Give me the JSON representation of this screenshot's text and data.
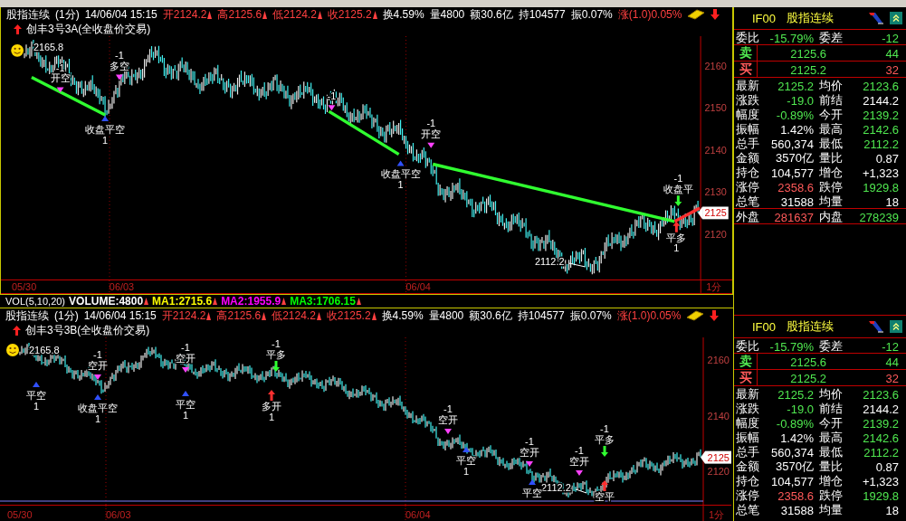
{
  "panes": [
    {
      "header": {
        "items": [
          {
            "kind": "title",
            "text": "股指连续"
          },
          {
            "kind": "stat",
            "text": "(1分)"
          },
          {
            "kind": "stat",
            "text": "14/06/04 15:15"
          },
          {
            "kind": "price",
            "text": "开2124.2"
          },
          {
            "kind": "price",
            "text": "高2125.6"
          },
          {
            "kind": "price",
            "text": "低2124.2"
          },
          {
            "kind": "price",
            "text": "收2125.2"
          },
          {
            "kind": "stat",
            "text": "换4.59%"
          },
          {
            "kind": "stat",
            "text": "量4800"
          },
          {
            "kind": "stat",
            "text": "额30.6亿"
          },
          {
            "kind": "stat",
            "text": "持104577"
          },
          {
            "kind": "stat",
            "text": "振0.07%"
          },
          {
            "kind": "change",
            "text": "涨(1.0)0.05%"
          }
        ]
      },
      "strategy": "创丰3号3A(全收盘价交易)",
      "high_label": "2165.8",
      "low_label": "2112.2",
      "price_tag": "2125",
      "y_ticks": [
        "2160",
        "2150",
        "2140",
        "2130",
        "2120"
      ],
      "dates": [
        "05/30",
        "06/03",
        "06/04"
      ],
      "period_label": "1分",
      "signals": [
        {
          "kind": "sell",
          "lines": [
            "-1",
            "开空"
          ]
        },
        {
          "kind": "sell",
          "lines": [
            "-1",
            "多空"
          ]
        },
        {
          "kind": "cover",
          "lines": [
            "收盘平空",
            "1"
          ]
        },
        {
          "kind": "sell",
          "lines": [
            "-1"
          ]
        },
        {
          "kind": "sell",
          "lines": [
            "-1",
            "开空"
          ]
        },
        {
          "kind": "cover",
          "lines": [
            "收盘平空",
            "1"
          ]
        },
        {
          "kind": "exit",
          "lines": [
            "-1",
            "收盘平"
          ]
        },
        {
          "kind": "buy",
          "lines": [
            "平多",
            "1"
          ]
        }
      ]
    },
    {
      "header": {
        "items": [
          {
            "kind": "title",
            "text": "股指连续"
          },
          {
            "kind": "stat",
            "text": "(1分)"
          },
          {
            "kind": "stat",
            "text": "14/06/04 15:15"
          },
          {
            "kind": "price",
            "text": "开2124.2"
          },
          {
            "kind": "price",
            "text": "高2125.6"
          },
          {
            "kind": "price",
            "text": "低2124.2"
          },
          {
            "kind": "price",
            "text": "收2125.2"
          },
          {
            "kind": "stat",
            "text": "换4.59%"
          },
          {
            "kind": "stat",
            "text": "量4800"
          },
          {
            "kind": "stat",
            "text": "额30.6亿"
          },
          {
            "kind": "stat",
            "text": "持104577"
          },
          {
            "kind": "stat",
            "text": "振0.07%"
          },
          {
            "kind": "change",
            "text": "涨(1.0)0.05%"
          }
        ]
      },
      "strategy": "创丰3号3B(全收盘价交易)",
      "high_label": "2165.8",
      "low_label": "2112.2",
      "price_tag": "2125",
      "y_ticks": [
        "2160",
        "2140",
        "2120"
      ],
      "dates": [
        "05/30",
        "06/03",
        "06/04"
      ],
      "period_label": "1分",
      "signals": [
        {
          "kind": "cover",
          "lines": [
            "平空",
            "1"
          ]
        },
        {
          "kind": "sell",
          "lines": [
            "-1",
            "空开"
          ]
        },
        {
          "kind": "cover",
          "lines": [
            "收盘平空",
            "1"
          ]
        },
        {
          "kind": "sell",
          "lines": [
            "-1",
            "空开"
          ]
        },
        {
          "kind": "cover",
          "lines": [
            "平空",
            "1"
          ]
        },
        {
          "kind": "exit",
          "lines": [
            "-1",
            "平多"
          ]
        },
        {
          "kind": "buy",
          "lines": [
            "多开",
            "1"
          ]
        },
        {
          "kind": "sell",
          "lines": [
            "-1",
            "空开"
          ]
        },
        {
          "kind": "cover",
          "lines": [
            "平空",
            "1"
          ]
        },
        {
          "kind": "sell",
          "lines": [
            "-1",
            "空开"
          ]
        },
        {
          "kind": "cover",
          "lines": [
            "平空"
          ]
        },
        {
          "kind": "sell",
          "lines": [
            "-1",
            "空开"
          ]
        },
        {
          "kind": "exit",
          "lines": [
            "-1",
            "平多"
          ]
        },
        {
          "kind": "buy",
          "lines": [
            "空平"
          ]
        }
      ]
    }
  ],
  "volume_bar": {
    "title": "VOL(5,10,20)",
    "items": [
      {
        "text": "VOLUME:4800",
        "color": "#ffffff"
      },
      {
        "text": "MA1:2715.6",
        "color": "#ffff00"
      },
      {
        "text": "MA2:1955.9",
        "color": "#ff00ff"
      },
      {
        "text": "MA3:1706.15",
        "color": "#00ff00"
      }
    ]
  },
  "info_panels": [
    {
      "code": "IF00",
      "name": "股指连续",
      "sections": [
        [
          {
            "kind": "pair",
            "left": {
              "label": "委比",
              "value": "-15.79%",
              "color": "#50e850"
            },
            "right": {
              "label": "委差",
              "value": "-12",
              "color": "#50e850"
            }
          }
        ],
        [
          {
            "kind": "book",
            "side": {
              "label": "卖",
              "color": "#50e850"
            },
            "price": {
              "value": "2125.6",
              "color": "#50e850"
            },
            "volume": {
              "value": "44",
              "color": "#50e850"
            }
          }
        ],
        [
          {
            "kind": "book",
            "side": {
              "label": "买",
              "color": "#ff5a5a"
            },
            "price": {
              "value": "2125.2",
              "color": "#50e850"
            },
            "volume": {
              "value": "32",
              "color": "#ff5a5a"
            }
          }
        ],
        [
          {
            "kind": "pair",
            "left": {
              "label": "最新",
              "value": "2125.2",
              "color": "#50e850"
            },
            "right": {
              "label": "均价",
              "value": "2123.6",
              "color": "#50e850"
            }
          },
          {
            "kind": "pair",
            "left": {
              "label": "涨跌",
              "value": "-19.0",
              "color": "#50e850"
            },
            "right": {
              "label": "前结",
              "value": "2144.2",
              "color": "#ffffff"
            }
          },
          {
            "kind": "pair",
            "left": {
              "label": "幅度",
              "value": "-0.89%",
              "color": "#50e850"
            },
            "right": {
              "label": "今开",
              "value": "2139.2",
              "color": "#50e850"
            }
          },
          {
            "kind": "pair",
            "left": {
              "label": "振幅",
              "value": "1.42%",
              "color": "#ffffff"
            },
            "right": {
              "label": "最高",
              "value": "2142.6",
              "color": "#50e850"
            }
          },
          {
            "kind": "pair",
            "left": {
              "label": "总手",
              "value": "560,374",
              "color": "#ffffff"
            },
            "right": {
              "label": "最低",
              "value": "2112.2",
              "color": "#50e850"
            }
          },
          {
            "kind": "pair",
            "left": {
              "label": "金额",
              "value": "3570亿",
              "color": "#ffffff"
            },
            "right": {
              "label": "量比",
              "value": "0.87",
              "color": "#ffffff"
            }
          },
          {
            "kind": "pair",
            "left": {
              "label": "持仓",
              "value": "104,577",
              "color": "#ffffff"
            },
            "right": {
              "label": "增仓",
              "value": "+1,323",
              "color": "#ffffff"
            }
          },
          {
            "kind": "pair",
            "left": {
              "label": "涨停",
              "value": "2358.6",
              "color": "#ff5a5a"
            },
            "right": {
              "label": "跌停",
              "value": "1929.8",
              "color": "#50e850"
            }
          },
          {
            "kind": "pair",
            "left": {
              "label": "总笔",
              "value": "31588",
              "color": "#ffffff"
            },
            "right": {
              "label": "均量",
              "value": "18",
              "color": "#ffffff"
            }
          }
        ],
        [
          {
            "kind": "pair",
            "left": {
              "label": "外盘",
              "value": "281637",
              "color": "#ff5a5a"
            },
            "right": {
              "label": "内盘",
              "value": "278239",
              "color": "#50e850"
            }
          }
        ]
      ]
    },
    {
      "code": "IF00",
      "name": "股指连续",
      "sections": [
        [
          {
            "kind": "pair",
            "left": {
              "label": "委比",
              "value": "-15.79%",
              "color": "#50e850"
            },
            "right": {
              "label": "委差",
              "value": "-12",
              "color": "#50e850"
            }
          }
        ],
        [
          {
            "kind": "book",
            "side": {
              "label": "卖",
              "color": "#50e850"
            },
            "price": {
              "value": "2125.6",
              "color": "#50e850"
            },
            "volume": {
              "value": "44",
              "color": "#50e850"
            }
          }
        ],
        [
          {
            "kind": "book",
            "side": {
              "label": "买",
              "color": "#ff5a5a"
            },
            "price": {
              "value": "2125.2",
              "color": "#50e850"
            },
            "volume": {
              "value": "32",
              "color": "#ff5a5a"
            }
          }
        ],
        [
          {
            "kind": "pair",
            "left": {
              "label": "最新",
              "value": "2125.2",
              "color": "#50e850"
            },
            "right": {
              "label": "均价",
              "value": "2123.6",
              "color": "#50e850"
            }
          },
          {
            "kind": "pair",
            "left": {
              "label": "涨跌",
              "value": "-19.0",
              "color": "#50e850"
            },
            "right": {
              "label": "前结",
              "value": "2144.2",
              "color": "#ffffff"
            }
          },
          {
            "kind": "pair",
            "left": {
              "label": "幅度",
              "value": "-0.89%",
              "color": "#50e850"
            },
            "right": {
              "label": "今开",
              "value": "2139.2",
              "color": "#50e850"
            }
          },
          {
            "kind": "pair",
            "left": {
              "label": "振幅",
              "value": "1.42%",
              "color": "#ffffff"
            },
            "right": {
              "label": "最高",
              "value": "2142.6",
              "color": "#50e850"
            }
          },
          {
            "kind": "pair",
            "left": {
              "label": "总手",
              "value": "560,374",
              "color": "#ffffff"
            },
            "right": {
              "label": "最低",
              "value": "2112.2",
              "color": "#50e850"
            }
          },
          {
            "kind": "pair",
            "left": {
              "label": "金额",
              "value": "3570亿",
              "color": "#ffffff"
            },
            "right": {
              "label": "量比",
              "value": "0.87",
              "color": "#ffffff"
            }
          },
          {
            "kind": "pair",
            "left": {
              "label": "持仓",
              "value": "104,577",
              "color": "#ffffff"
            },
            "right": {
              "label": "增仓",
              "value": "+1,323",
              "color": "#ffffff"
            }
          },
          {
            "kind": "pair",
            "left": {
              "label": "涨停",
              "value": "2358.6",
              "color": "#ff5a5a"
            },
            "right": {
              "label": "跌停",
              "value": "1929.8",
              "color": "#50e850"
            }
          },
          {
            "kind": "pair",
            "left": {
              "label": "总笔",
              "value": "31588",
              "color": "#ffffff"
            },
            "right": {
              "label": "均量",
              "value": "18",
              "color": "#ffffff"
            }
          }
        ]
      ]
    }
  ]
}
